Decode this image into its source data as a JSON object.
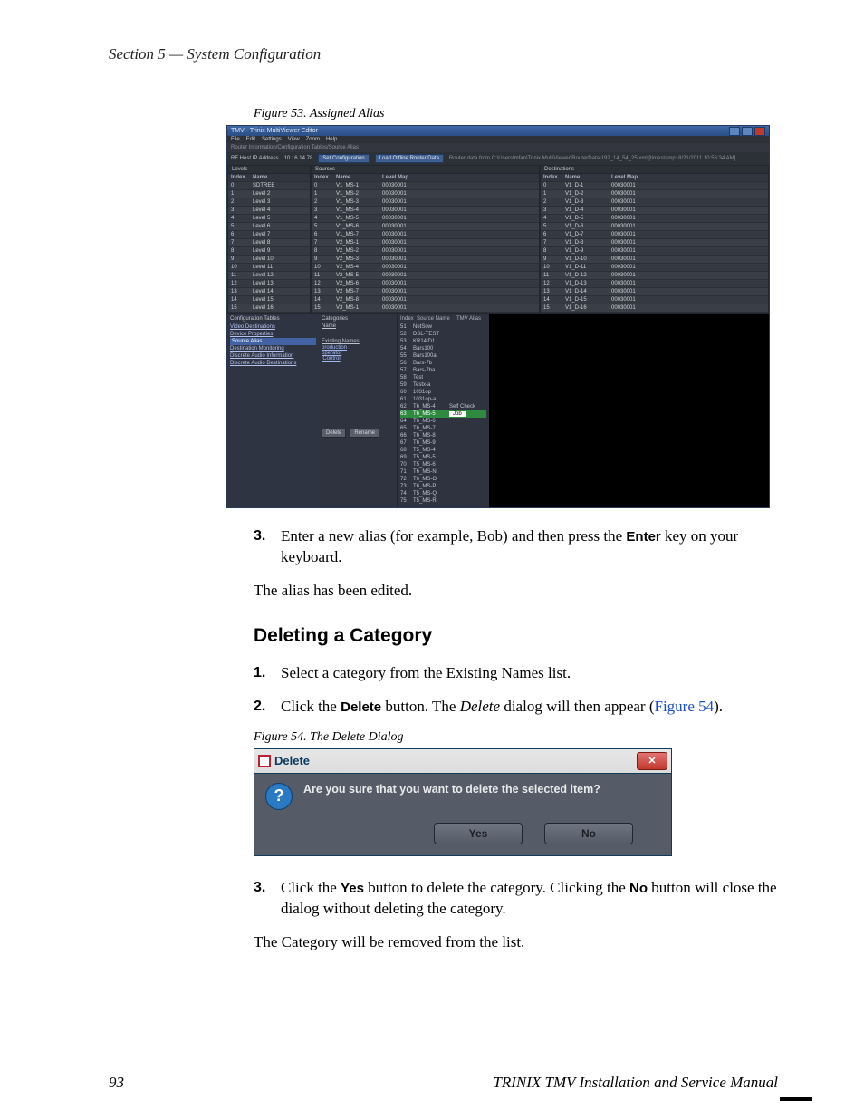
{
  "running_head": "Section 5 — System Configuration",
  "figure53": {
    "caption": "Figure 53.  Assigned Alias",
    "window_title": "TMV - Trinix MultiViewer Editor",
    "menus": [
      "File",
      "Edit",
      "Settings",
      "View",
      "Zoom",
      "Help"
    ],
    "crumbs": "Router Information/Configuration Tables/Source Alias",
    "ip_label": "RF Host IP Address",
    "ip_value": "10.16.14.78",
    "set_cfg_btn": "Set Configuration",
    "load_btn": "Load Offline Router Data",
    "path_text": "Router data from C:\\Users\\mfan\\Trinix MultiViewer\\RouterData\\192_14_54_25.xml [timestamp: 8/21/2011 10:56:34 AM]",
    "levels": {
      "title": "Levels",
      "cols": [
        "Index",
        "Name"
      ],
      "rows": [
        [
          "0",
          "SDTREE"
        ],
        [
          "1",
          "Level 2"
        ],
        [
          "2",
          "Level 3"
        ],
        [
          "3",
          "Level 4"
        ],
        [
          "4",
          "Level 5"
        ],
        [
          "5",
          "Level 6"
        ],
        [
          "6",
          "Level 7"
        ],
        [
          "7",
          "Level 8"
        ],
        [
          "8",
          "Level 9"
        ],
        [
          "9",
          "Level 10"
        ],
        [
          "10",
          "Level 11"
        ],
        [
          "11",
          "Level 12"
        ],
        [
          "12",
          "Level 13"
        ],
        [
          "13",
          "Level 14"
        ],
        [
          "14",
          "Level 15"
        ],
        [
          "15",
          "Level 16"
        ]
      ]
    },
    "sources": {
      "title": "Sources",
      "cols": [
        "Index",
        "Name",
        "Level Map"
      ],
      "rows": [
        [
          "0",
          "V1_MS-1",
          "00030001"
        ],
        [
          "1",
          "V1_MS-2",
          "00030001"
        ],
        [
          "2",
          "V1_MS-3",
          "00030001"
        ],
        [
          "3",
          "V1_MS-4",
          "00030001"
        ],
        [
          "4",
          "V1_MS-5",
          "00030001"
        ],
        [
          "5",
          "V1_MS-6",
          "00030001"
        ],
        [
          "6",
          "V1_MS-7",
          "00030001"
        ],
        [
          "7",
          "V2_MS-1",
          "00030001"
        ],
        [
          "8",
          "V2_MS-2",
          "00030001"
        ],
        [
          "9",
          "V2_MS-3",
          "00030001"
        ],
        [
          "10",
          "V2_MS-4",
          "00030001"
        ],
        [
          "11",
          "V2_MS-5",
          "00030001"
        ],
        [
          "12",
          "V2_MS-6",
          "00030001"
        ],
        [
          "13",
          "V2_MS-7",
          "00030001"
        ],
        [
          "14",
          "V2_MS-8",
          "00030001"
        ],
        [
          "15",
          "V3_MS-1",
          "00030001"
        ]
      ]
    },
    "destinations": {
      "title": "Destinations",
      "cols": [
        "Index",
        "Name",
        "Level Map"
      ],
      "rows": [
        [
          "0",
          "V1_D-1",
          "00030001"
        ],
        [
          "1",
          "V1_D-2",
          "00030001"
        ],
        [
          "2",
          "V1_D-3",
          "00030001"
        ],
        [
          "3",
          "V1_D-4",
          "00030001"
        ],
        [
          "4",
          "V1_D-5",
          "00030001"
        ],
        [
          "5",
          "V1_D-6",
          "00030001"
        ],
        [
          "6",
          "V1_D-7",
          "00030001"
        ],
        [
          "7",
          "V1_D-8",
          "00030001"
        ],
        [
          "8",
          "V1_D-9",
          "00030001"
        ],
        [
          "9",
          "V1_D-10",
          "00030001"
        ],
        [
          "10",
          "V1_D-11",
          "00030001"
        ],
        [
          "11",
          "V1_D-12",
          "00030001"
        ],
        [
          "12",
          "V1_D-13",
          "00030001"
        ],
        [
          "13",
          "V1_D-14",
          "00030001"
        ],
        [
          "14",
          "V1_D-15",
          "00030001"
        ],
        [
          "15",
          "V1_D-16",
          "00030001"
        ]
      ]
    },
    "config_tabs": {
      "title": "Configuration Tables",
      "items": [
        "Video Destinations",
        "Device Properties",
        "Source Alias",
        "Destination Monitoring",
        "Discrete Audio Information",
        "Discrete Audio Destinations"
      ],
      "selected": "Source Alias"
    },
    "categories": {
      "title": "Categories",
      "items_label": "Name",
      "existing_label": "Existing Names",
      "items": [
        "production",
        "operator",
        "iControl"
      ],
      "buttons": [
        "Delete",
        "Rename"
      ]
    },
    "namelist": {
      "header": [
        "Index",
        "Source Name",
        "TMV Alias"
      ],
      "rows": [
        [
          "51",
          "NetSow",
          ""
        ],
        [
          "52",
          "DSL-TEST",
          ""
        ],
        [
          "53",
          "KR14ID1",
          ""
        ],
        [
          "54",
          "Bars100",
          ""
        ],
        [
          "55",
          "Bars100a",
          ""
        ],
        [
          "56",
          "Bars-7b",
          ""
        ],
        [
          "57",
          "Bars-7ba",
          ""
        ],
        [
          "58",
          "Test",
          ""
        ],
        [
          "59",
          "Testx-a",
          ""
        ],
        [
          "60",
          "1031op",
          ""
        ],
        [
          "61",
          "1031op-a",
          ""
        ],
        [
          "62",
          "T6_MS-4",
          "Self Check"
        ],
        [
          "63",
          "T6_MS-5",
          "Job"
        ],
        [
          "64",
          "T6_MS-6",
          ""
        ],
        [
          "65",
          "T6_MS-7",
          ""
        ],
        [
          "66",
          "T6_MS-8",
          ""
        ],
        [
          "67",
          "T6_MS-9",
          ""
        ],
        [
          "68",
          "T5_MS-4",
          ""
        ],
        [
          "69",
          "T5_MS-5",
          ""
        ],
        [
          "70",
          "T5_MS-6",
          ""
        ],
        [
          "71",
          "T6_MS-N",
          ""
        ],
        [
          "72",
          "T6_MS-O",
          ""
        ],
        [
          "73",
          "T6_MS-P",
          ""
        ],
        [
          "74",
          "T5_MS-Q",
          ""
        ],
        [
          "75",
          "T5_MS-R",
          ""
        ]
      ],
      "highlight_index": 12
    }
  },
  "step3a": {
    "num": "3.",
    "text_before": "Enter a new alias (for example, Bob) and then press the ",
    "key": "Enter",
    "text_after": " key on your keyboard."
  },
  "para_edited": "The alias has been edited.",
  "heading_delete": "Deleting a Category",
  "del_step1": {
    "num": "1.",
    "text": "Select a category from the Existing Names list."
  },
  "del_step2": {
    "num": "2.",
    "t1": "Click the ",
    "btn": "Delete",
    "t2": " button. The ",
    "em": "Delete",
    "t3": " dialog will then appear (",
    "fig": "Figure 54",
    "t4": ")."
  },
  "figure54": {
    "caption": "Figure 54.  The Delete Dialog",
    "title": "Delete",
    "close": "✕",
    "question_mark": "?",
    "message": "Are you sure that you want to delete the selected item?",
    "yes": "Yes",
    "no": "No"
  },
  "del_step3": {
    "num": "3.",
    "t1": "Click the ",
    "yes": "Yes",
    "t2": " button to delete the category. Clicking the ",
    "no": "No",
    "t3": " button will close the dialog without deleting the category."
  },
  "para_removed": "The Category will be removed from the list.",
  "footer": {
    "page": "93",
    "manual": "TRINIX TMV Installation and Service Manual"
  }
}
